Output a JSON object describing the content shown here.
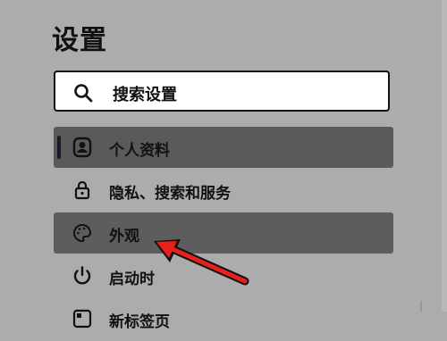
{
  "header": {
    "title": "设置"
  },
  "search": {
    "placeholder": "搜索设置"
  },
  "nav": {
    "items": [
      {
        "label": "个人资料",
        "icon": "profile-icon",
        "state": "selected"
      },
      {
        "label": "隐私、搜索和服务",
        "icon": "lock-icon"
      },
      {
        "label": "外观",
        "icon": "palette-icon",
        "state": "hover"
      },
      {
        "label": "启动时",
        "icon": "power-icon"
      },
      {
        "label": "新标签页",
        "icon": "new-tab-icon"
      }
    ]
  },
  "colors": {
    "background": "#acacac",
    "selected": "#5a5a5a",
    "accent_arrow": "#e8201c"
  }
}
